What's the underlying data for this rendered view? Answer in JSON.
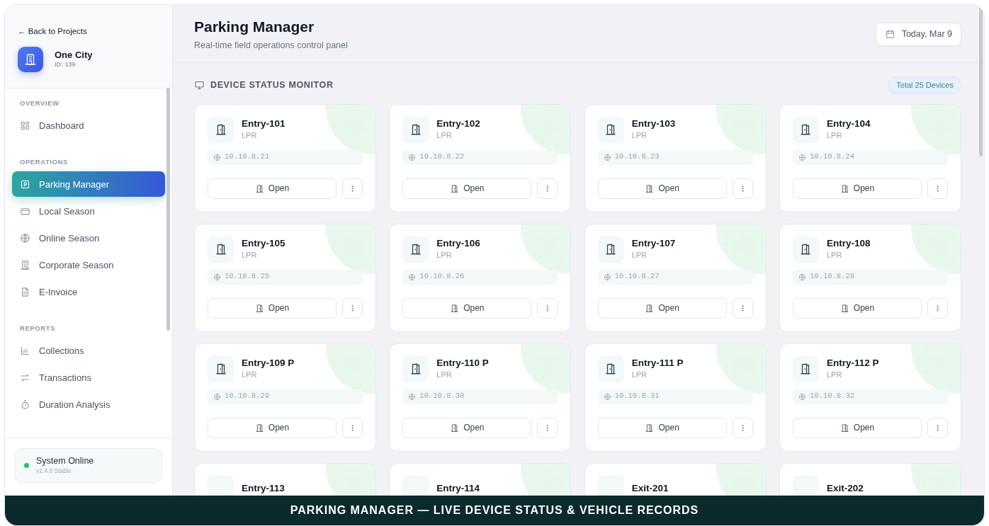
{
  "sidebar": {
    "back_link": "← Back to Projects",
    "project": {
      "name": "One City",
      "id": "ID: 139"
    },
    "sections": [
      {
        "label": "OVERVIEW",
        "items": [
          {
            "label": "Dashboard",
            "selected": false
          }
        ]
      },
      {
        "label": "OPERATIONS",
        "items": [
          {
            "label": "Parking Manager",
            "selected": true
          },
          {
            "label": "Local Season",
            "selected": false
          },
          {
            "label": "Online Season",
            "selected": false
          },
          {
            "label": "Corporate Season",
            "selected": false
          },
          {
            "label": "E-Invoice",
            "selected": false
          }
        ]
      },
      {
        "label": "REPORTS",
        "items": [
          {
            "label": "Collections",
            "selected": false
          },
          {
            "label": "Transactions",
            "selected": false
          },
          {
            "label": "Duration Analysis",
            "selected": false
          }
        ]
      }
    ],
    "status": {
      "title": "System Online",
      "version": "v2.4.0 Stable",
      "color": "#22c55e"
    }
  },
  "header": {
    "title": "Parking Manager",
    "subtitle": "Real-time field operations control panel",
    "date_button": "Today, Mar 9"
  },
  "section": {
    "title": "DEVICE STATUS MONITOR",
    "badge": "Total 25 Devices"
  },
  "devices": [
    {
      "name": "Entry-101",
      "type": "LPR",
      "ip": "10.10.8.21",
      "action": "Open"
    },
    {
      "name": "Entry-102",
      "type": "LPR",
      "ip": "10.10.8.22",
      "action": "Open"
    },
    {
      "name": "Entry-103",
      "type": "LPR",
      "ip": "10.10.8.23",
      "action": "Open"
    },
    {
      "name": "Entry-104",
      "type": "LPR",
      "ip": "10.10.8.24",
      "action": "Open"
    },
    {
      "name": "Entry-105",
      "type": "LPR",
      "ip": "10.10.8.25",
      "action": "Open"
    },
    {
      "name": "Entry-106",
      "type": "LPR",
      "ip": "10.10.8.26",
      "action": "Open"
    },
    {
      "name": "Entry-107",
      "type": "LPR",
      "ip": "10.10.8.27",
      "action": "Open"
    },
    {
      "name": "Entry-108",
      "type": "LPR",
      "ip": "10.10.8.28",
      "action": "Open"
    },
    {
      "name": "Entry-109 P",
      "type": "LPR",
      "ip": "10.10.8.29",
      "action": "Open"
    },
    {
      "name": "Entry-110 P",
      "type": "LPR",
      "ip": "10.10.8.30",
      "action": "Open"
    },
    {
      "name": "Entry-111 P",
      "type": "LPR",
      "ip": "10.10.8.31",
      "action": "Open"
    },
    {
      "name": "Entry-112 P",
      "type": "LPR",
      "ip": "10.10.8.32",
      "action": "Open"
    },
    {
      "name": "Entry-113"
    },
    {
      "name": "Entry-114"
    },
    {
      "name": "Exit-201"
    },
    {
      "name": "Exit-202"
    }
  ],
  "caption_banner": "PARKING MANAGER — LIVE DEVICE STATUS & VEHICLE RECORDS"
}
